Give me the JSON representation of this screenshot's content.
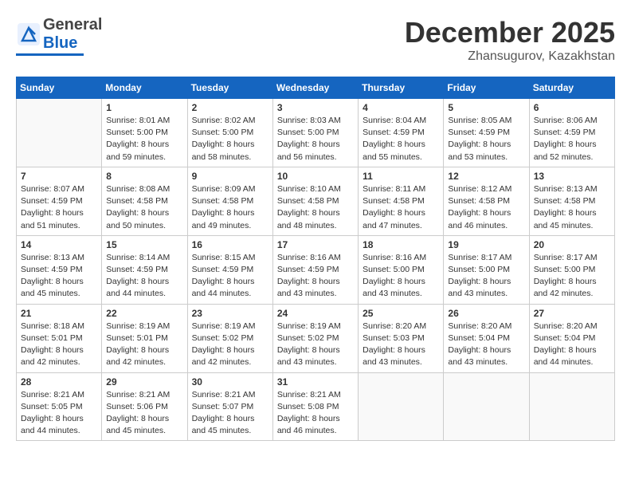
{
  "header": {
    "logo_general": "General",
    "logo_blue": "Blue",
    "month_title": "December 2025",
    "location": "Zhansugurov, Kazakhstan"
  },
  "days_of_week": [
    "Sunday",
    "Monday",
    "Tuesday",
    "Wednesday",
    "Thursday",
    "Friday",
    "Saturday"
  ],
  "weeks": [
    [
      {
        "day": "",
        "info": ""
      },
      {
        "day": "1",
        "info": "Sunrise: 8:01 AM\nSunset: 5:00 PM\nDaylight: 8 hours\nand 59 minutes."
      },
      {
        "day": "2",
        "info": "Sunrise: 8:02 AM\nSunset: 5:00 PM\nDaylight: 8 hours\nand 58 minutes."
      },
      {
        "day": "3",
        "info": "Sunrise: 8:03 AM\nSunset: 5:00 PM\nDaylight: 8 hours\nand 56 minutes."
      },
      {
        "day": "4",
        "info": "Sunrise: 8:04 AM\nSunset: 4:59 PM\nDaylight: 8 hours\nand 55 minutes."
      },
      {
        "day": "5",
        "info": "Sunrise: 8:05 AM\nSunset: 4:59 PM\nDaylight: 8 hours\nand 53 minutes."
      },
      {
        "day": "6",
        "info": "Sunrise: 8:06 AM\nSunset: 4:59 PM\nDaylight: 8 hours\nand 52 minutes."
      }
    ],
    [
      {
        "day": "7",
        "info": "Sunrise: 8:07 AM\nSunset: 4:59 PM\nDaylight: 8 hours\nand 51 minutes."
      },
      {
        "day": "8",
        "info": "Sunrise: 8:08 AM\nSunset: 4:58 PM\nDaylight: 8 hours\nand 50 minutes."
      },
      {
        "day": "9",
        "info": "Sunrise: 8:09 AM\nSunset: 4:58 PM\nDaylight: 8 hours\nand 49 minutes."
      },
      {
        "day": "10",
        "info": "Sunrise: 8:10 AM\nSunset: 4:58 PM\nDaylight: 8 hours\nand 48 minutes."
      },
      {
        "day": "11",
        "info": "Sunrise: 8:11 AM\nSunset: 4:58 PM\nDaylight: 8 hours\nand 47 minutes."
      },
      {
        "day": "12",
        "info": "Sunrise: 8:12 AM\nSunset: 4:58 PM\nDaylight: 8 hours\nand 46 minutes."
      },
      {
        "day": "13",
        "info": "Sunrise: 8:13 AM\nSunset: 4:58 PM\nDaylight: 8 hours\nand 45 minutes."
      }
    ],
    [
      {
        "day": "14",
        "info": "Sunrise: 8:13 AM\nSunset: 4:59 PM\nDaylight: 8 hours\nand 45 minutes."
      },
      {
        "day": "15",
        "info": "Sunrise: 8:14 AM\nSunset: 4:59 PM\nDaylight: 8 hours\nand 44 minutes."
      },
      {
        "day": "16",
        "info": "Sunrise: 8:15 AM\nSunset: 4:59 PM\nDaylight: 8 hours\nand 44 minutes."
      },
      {
        "day": "17",
        "info": "Sunrise: 8:16 AM\nSunset: 4:59 PM\nDaylight: 8 hours\nand 43 minutes."
      },
      {
        "day": "18",
        "info": "Sunrise: 8:16 AM\nSunset: 5:00 PM\nDaylight: 8 hours\nand 43 minutes."
      },
      {
        "day": "19",
        "info": "Sunrise: 8:17 AM\nSunset: 5:00 PM\nDaylight: 8 hours\nand 43 minutes."
      },
      {
        "day": "20",
        "info": "Sunrise: 8:17 AM\nSunset: 5:00 PM\nDaylight: 8 hours\nand 42 minutes."
      }
    ],
    [
      {
        "day": "21",
        "info": "Sunrise: 8:18 AM\nSunset: 5:01 PM\nDaylight: 8 hours\nand 42 minutes."
      },
      {
        "day": "22",
        "info": "Sunrise: 8:19 AM\nSunset: 5:01 PM\nDaylight: 8 hours\nand 42 minutes."
      },
      {
        "day": "23",
        "info": "Sunrise: 8:19 AM\nSunset: 5:02 PM\nDaylight: 8 hours\nand 42 minutes."
      },
      {
        "day": "24",
        "info": "Sunrise: 8:19 AM\nSunset: 5:02 PM\nDaylight: 8 hours\nand 43 minutes."
      },
      {
        "day": "25",
        "info": "Sunrise: 8:20 AM\nSunset: 5:03 PM\nDaylight: 8 hours\nand 43 minutes."
      },
      {
        "day": "26",
        "info": "Sunrise: 8:20 AM\nSunset: 5:04 PM\nDaylight: 8 hours\nand 43 minutes."
      },
      {
        "day": "27",
        "info": "Sunrise: 8:20 AM\nSunset: 5:04 PM\nDaylight: 8 hours\nand 44 minutes."
      }
    ],
    [
      {
        "day": "28",
        "info": "Sunrise: 8:21 AM\nSunset: 5:05 PM\nDaylight: 8 hours\nand 44 minutes."
      },
      {
        "day": "29",
        "info": "Sunrise: 8:21 AM\nSunset: 5:06 PM\nDaylight: 8 hours\nand 45 minutes."
      },
      {
        "day": "30",
        "info": "Sunrise: 8:21 AM\nSunset: 5:07 PM\nDaylight: 8 hours\nand 45 minutes."
      },
      {
        "day": "31",
        "info": "Sunrise: 8:21 AM\nSunset: 5:08 PM\nDaylight: 8 hours\nand 46 minutes."
      },
      {
        "day": "",
        "info": ""
      },
      {
        "day": "",
        "info": ""
      },
      {
        "day": "",
        "info": ""
      }
    ]
  ]
}
